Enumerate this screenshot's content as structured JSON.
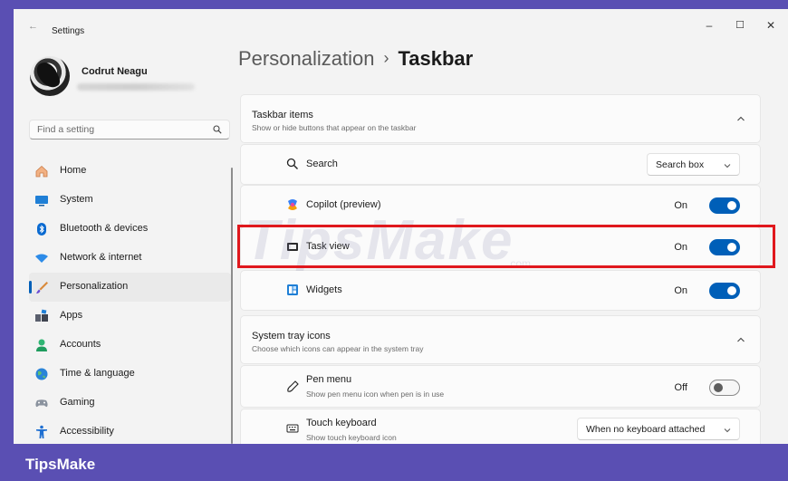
{
  "window": {
    "back_glyph": "←",
    "title": "Settings",
    "minimize": "–",
    "maximize": "☐",
    "close": "✕"
  },
  "user": {
    "name": "Codrut Neagu"
  },
  "search": {
    "placeholder": "Find a setting"
  },
  "sidebar": {
    "items": [
      {
        "label": "Home",
        "icon": "home-icon"
      },
      {
        "label": "System",
        "icon": "system-icon"
      },
      {
        "label": "Bluetooth & devices",
        "icon": "bluetooth-icon"
      },
      {
        "label": "Network & internet",
        "icon": "network-icon"
      },
      {
        "label": "Personalization",
        "icon": "brush-icon",
        "active": true
      },
      {
        "label": "Apps",
        "icon": "apps-icon"
      },
      {
        "label": "Accounts",
        "icon": "accounts-icon"
      },
      {
        "label": "Time & language",
        "icon": "globe-icon"
      },
      {
        "label": "Gaming",
        "icon": "gamepad-icon"
      },
      {
        "label": "Accessibility",
        "icon": "accessibility-icon"
      }
    ]
  },
  "breadcrumb": {
    "parent": "Personalization",
    "separator": "›",
    "current": "Taskbar"
  },
  "taskbar_items": {
    "title": "Taskbar items",
    "subtitle": "Show or hide buttons that appear on the taskbar",
    "search": {
      "label": "Search",
      "value": "Search box"
    },
    "copilot": {
      "label": "Copilot (preview)",
      "state": "On"
    },
    "task_view": {
      "label": "Task view",
      "state": "On"
    },
    "widgets": {
      "label": "Widgets",
      "state": "On"
    }
  },
  "system_tray": {
    "title": "System tray icons",
    "subtitle": "Choose which icons can appear in the system tray",
    "pen_menu": {
      "label": "Pen menu",
      "description": "Show pen menu icon when pen is in use",
      "state": "Off"
    },
    "touch_keyboard": {
      "label": "Touch keyboard",
      "description": "Show touch keyboard icon",
      "value": "When no keyboard attached"
    }
  },
  "watermark": {
    "text": "TipsMake",
    "suffix": ".com"
  },
  "brand": {
    "name": "TipsMake"
  },
  "colors": {
    "accent": "#005fb8",
    "highlight": "#e0181d",
    "brand_bar": "#5a4fb3"
  }
}
